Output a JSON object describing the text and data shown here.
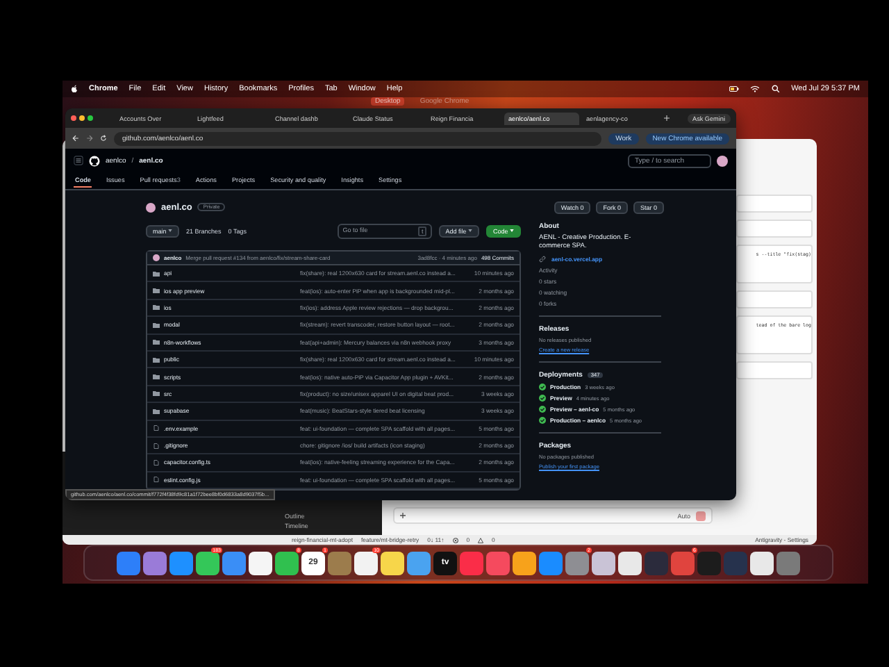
{
  "menu_bar": {
    "app": "Chrome",
    "items": [
      "File",
      "Edit",
      "View",
      "History",
      "Bookmarks",
      "Profiles",
      "Tab",
      "Window",
      "Help"
    ],
    "clock": "Wed Jul 29  5:37 PM"
  },
  "spaces": [
    {
      "label": "Desktop",
      "selected": true
    },
    {
      "label": "Google Chrome",
      "selected": false
    }
  ],
  "browser": {
    "tabs": [
      {
        "label": "Accounts Over",
        "selected": false
      },
      {
        "label": "Lightfeed",
        "selected": false
      },
      {
        "label": "Channel dashb",
        "selected": false
      },
      {
        "label": "Claude Status",
        "selected": false
      },
      {
        "label": "Reign Financia",
        "selected": false
      },
      {
        "label": "aenlco/aenl.co",
        "selected": true
      },
      {
        "label": "aenlagency-co",
        "selected": false
      }
    ],
    "ask_button": "Ask Gemini",
    "url": "github.com/aenlco/aenl.co",
    "profile": "Work",
    "update_button": "New Chrome available"
  },
  "github": {
    "owner": "aenlco",
    "separator": "/",
    "repo": "aenl.co",
    "search_placeholder": "Type / to search",
    "nav": [
      {
        "label": "Code",
        "selected": true
      },
      {
        "label": "Issues",
        "selected": false
      },
      {
        "label": "Pull requests",
        "count": "3",
        "selected": false
      },
      {
        "label": "Actions",
        "selected": false
      },
      {
        "label": "Projects",
        "selected": false
      },
      {
        "label": "Security and quality",
        "selected": false
      },
      {
        "label": "Insights",
        "selected": false
      },
      {
        "label": "Settings",
        "selected": false
      }
    ],
    "repo_title": "aenl.co",
    "visibility": "Private",
    "watch": {
      "label": "Watch",
      "count": "0"
    },
    "fork": {
      "label": "Fork",
      "count": "0"
    },
    "star": {
      "label": "Star",
      "count": "0"
    },
    "branch": "main",
    "branches": "21 Branches",
    "tags": "0 Tags",
    "go_to_file": "Go to file",
    "go_to_file_key": "t",
    "add_file": "Add file",
    "code_button": "Code",
    "commit": {
      "author": "aenlco",
      "message": "Merge pull request #134 from aenlco/fix/stream-share-card",
      "meta": "3ad8fcc · 4 minutes ago",
      "count": "498 Commits"
    },
    "files": [
      {
        "kind": "folder",
        "name": "api",
        "message": "fix(share): real 1200x630 card for stream.aenl.co instead a...",
        "time": "10 minutes ago"
      },
      {
        "kind": "folder",
        "name": "ios app preview",
        "message": "feat(ios): auto-enter PiP when app is backgrounded mid-pl...",
        "time": "2 months ago"
      },
      {
        "kind": "folder",
        "name": "ios",
        "message": "fix(ios): address Apple review rejections — drop backgrou...",
        "time": "2 months ago"
      },
      {
        "kind": "folder",
        "name": "modal",
        "message": "fix(stream): revert transcoder, restore button layout — root...",
        "time": "2 months ago"
      },
      {
        "kind": "folder",
        "name": "n8n-workflows",
        "message": "feat(api+admin): Mercury balances via n8n webhook proxy",
        "time": "3 months ago"
      },
      {
        "kind": "folder",
        "name": "public",
        "message": "fix(share): real 1200x630 card for stream.aenl.co instead a...",
        "time": "10 minutes ago"
      },
      {
        "kind": "folder",
        "name": "scripts",
        "message": "feat(ios): native auto-PiP via Capacitor App plugin + AVKit...",
        "time": "2 months ago"
      },
      {
        "kind": "folder",
        "name": "src",
        "message": "fix(product): no size/unisex apparel UI on digital beat prod...",
        "time": "3 weeks ago"
      },
      {
        "kind": "folder",
        "name": "supabase",
        "message": "feat(music): BeatStars-style tiered beat licensing",
        "time": "3 weeks ago"
      },
      {
        "kind": "file",
        "name": ".env.example",
        "message": "feat: ui-foundation — complete SPA scaffold with all pages...",
        "time": "5 months ago"
      },
      {
        "kind": "file",
        "name": ".gitignore",
        "message": "chore: gitignore /ios/ build artifacts (icon staging)",
        "time": "2 months ago"
      },
      {
        "kind": "file",
        "name": "capacitor.config.ts",
        "message": "feat(ios): native-feeling streaming experience for the Capa...",
        "time": "2 months ago"
      },
      {
        "kind": "file",
        "name": "eslint.config.js",
        "message": "feat: ui-foundation — complete SPA scaffold with all pages...",
        "time": "5 months ago"
      }
    ],
    "link_preview": "github.com/aenlco/aenl.co/commit/f772f4f38fd9c81a1f72bee8bf0d6833a8d9037f5b...",
    "about": {
      "title": "About",
      "description": "AENL - Creative Production. E-commerce SPA.",
      "link": "aenl-co.vercel.app",
      "stats": [
        "Activity",
        "0 stars",
        "0 watching",
        "0 forks"
      ]
    },
    "releases": {
      "title": "Releases",
      "note": "No releases published",
      "link": "Create a new release"
    },
    "deployments": {
      "title": "Deployments",
      "count": "347",
      "items": [
        {
          "name": "Production",
          "time": "3 weeks ago"
        },
        {
          "name": "Preview",
          "time": "4 minutes ago"
        },
        {
          "name": "Preview – aenl-co",
          "time": "5 months ago"
        },
        {
          "name": "Production – aenlco",
          "time": "5 months ago"
        }
      ]
    },
    "packages": {
      "title": "Packages",
      "note": "No packages published",
      "link": "Publish your first package"
    }
  },
  "editor": {
    "snippets": [
      "s --title \"fix(stag)",
      "tead of the bare log"
    ],
    "sidebar": [
      "Outline",
      "Timeline"
    ],
    "model": "Auto",
    "status": {
      "branch": "reign-financial-mt-adopt",
      "remote": "feature/mt-bridge-retry",
      "sync": "0↓ 11↑",
      "errors": "0",
      "warnings": "0",
      "right": "Antigravity - Settings"
    }
  },
  "dock": [
    {
      "color": "#2d7ff9"
    },
    {
      "color": "#9a7bd8"
    },
    {
      "color": "#1e90ff"
    },
    {
      "color": "#34c759",
      "badge": "183"
    },
    {
      "color": "#3a8ef6"
    },
    {
      "color": "#f5f5f5"
    },
    {
      "color": "#30c04f",
      "badge": "8"
    },
    {
      "color": "#ffffff",
      "label": "29",
      "badge": "1"
    },
    {
      "color": "#9c7c4c"
    },
    {
      "color": "#f2f2f2",
      "badge": "10"
    },
    {
      "color": "#f7d64a"
    },
    {
      "color": "#4aa3f0"
    },
    {
      "color": "#111111",
      "label": "tv"
    },
    {
      "color": "#fa2d48"
    },
    {
      "color": "#f54a5e"
    },
    {
      "color": "#f7a21b"
    },
    {
      "color": "#1a8cff"
    },
    {
      "color": "#8e8e93",
      "badge": "2"
    },
    {
      "color": "#c9c3d6"
    },
    {
      "color": "#e8e8e8"
    },
    {
      "color": "#2b2b3c"
    },
    {
      "color": "#e0443e",
      "badge": "6"
    },
    {
      "color": "#1c1c1c"
    },
    {
      "color": "#26324d"
    },
    {
      "color": "#e8e8e8"
    },
    {
      "color": "#7a7a7a"
    }
  ]
}
